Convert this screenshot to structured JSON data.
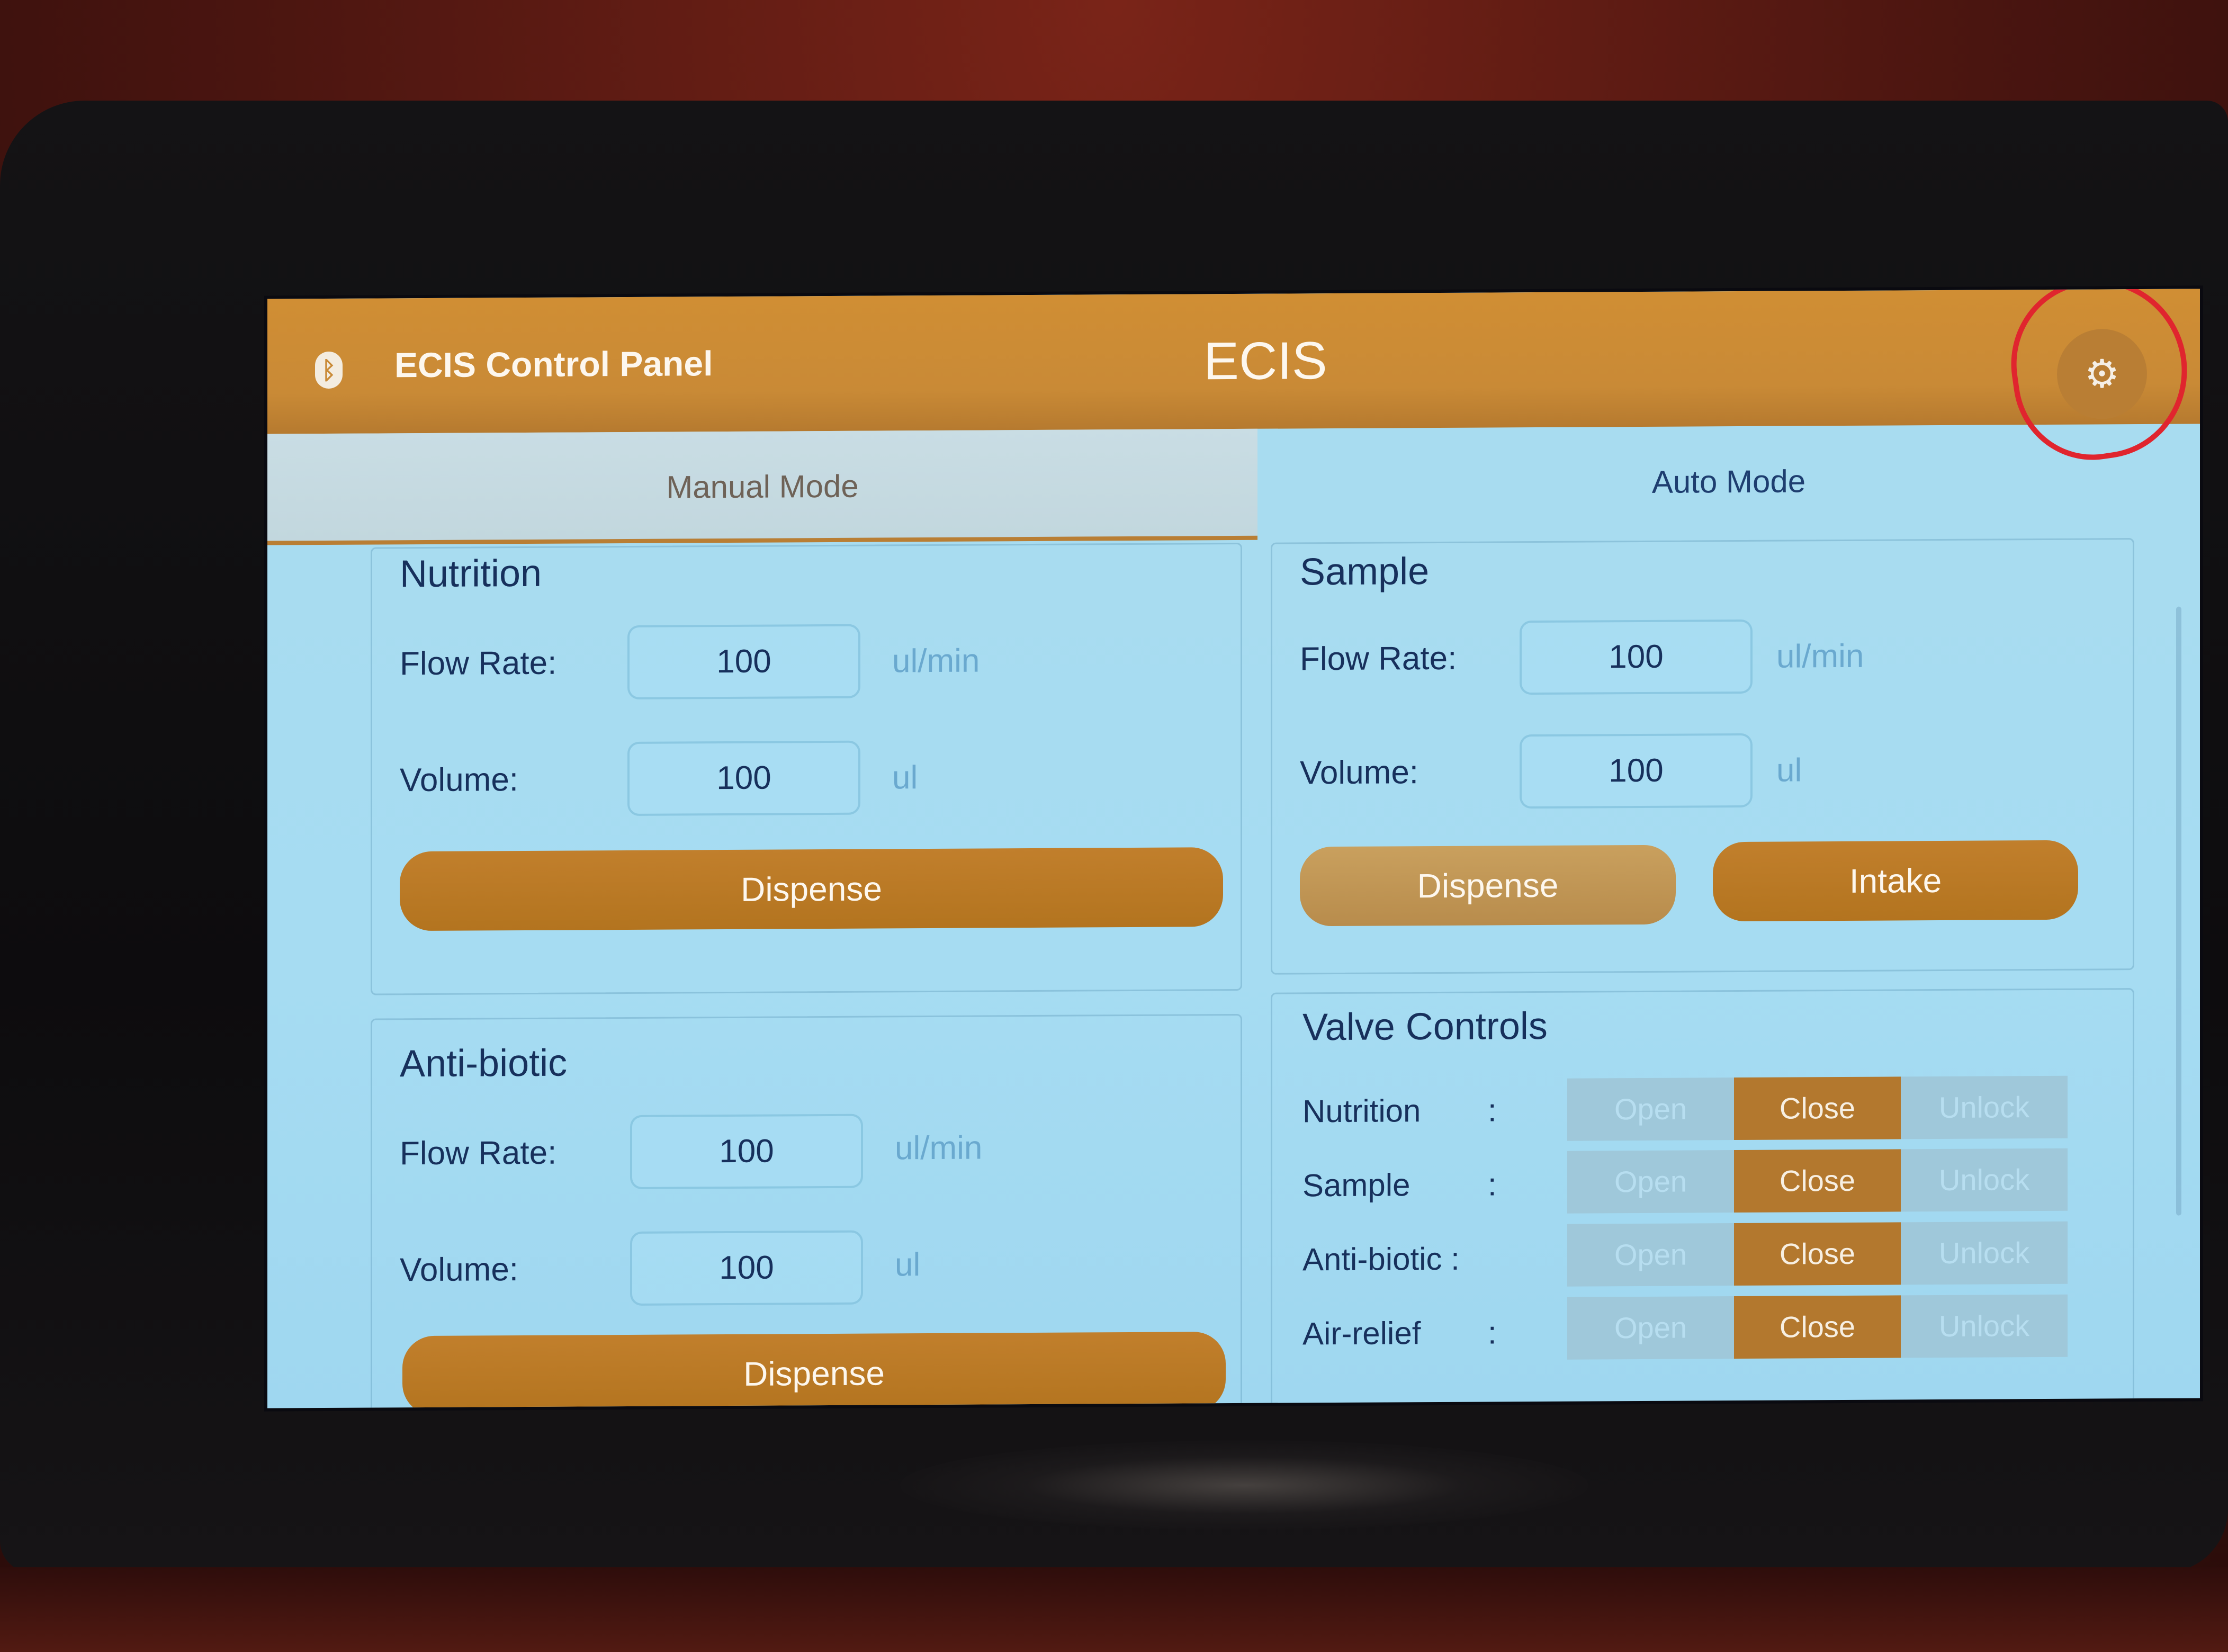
{
  "header": {
    "bluetooth_icon": "bluetooth-icon",
    "app_title": "ECIS Control Panel",
    "brand": "ECIS",
    "settings_icon": "gear-icon",
    "highlight_color": "#e0252e"
  },
  "tabs": [
    {
      "label": "Manual Mode",
      "selected": false
    },
    {
      "label": "Auto Mode",
      "selected": true
    }
  ],
  "nutrition": {
    "title": "Nutrition",
    "flow_rate_label": "Flow Rate:",
    "flow_rate_value": "100",
    "flow_rate_unit": "ul/min",
    "volume_label": "Volume:",
    "volume_value": "100",
    "volume_unit": "ul",
    "dispense_label": "Dispense"
  },
  "sample": {
    "title": "Sample",
    "flow_rate_label": "Flow Rate:",
    "flow_rate_value": "100",
    "flow_rate_unit": "ul/min",
    "volume_label": "Volume:",
    "volume_value": "100",
    "volume_unit": "ul",
    "dispense_label": "Dispense",
    "intake_label": "Intake"
  },
  "antibiotic": {
    "title": "Anti-biotic",
    "flow_rate_label": "Flow Rate:",
    "flow_rate_value": "100",
    "flow_rate_unit": "ul/min",
    "volume_label": "Volume:",
    "volume_value": "100",
    "volume_unit": "ul",
    "dispense_label": "Dispense"
  },
  "valves": {
    "title": "Valve Controls",
    "rows": [
      {
        "name": "Nutrition",
        "sep": ":",
        "open": "Open",
        "close": "Close",
        "unlock": "Unlock",
        "state": "Close"
      },
      {
        "name": "Sample",
        "sep": ":",
        "open": "Open",
        "close": "Close",
        "unlock": "Unlock",
        "state": "Close"
      },
      {
        "name": "Anti-biotic :",
        "sep": "",
        "open": "Open",
        "close": "Close",
        "unlock": "Unlock",
        "state": "Close"
      },
      {
        "name": "Air-relief",
        "sep": ":",
        "open": "Open",
        "close": "Close",
        "unlock": "Unlock",
        "state": "Close"
      }
    ]
  },
  "colors": {
    "accent": "#c98a36",
    "screen_bg": "#a6dcf2",
    "text": "#17305c"
  }
}
